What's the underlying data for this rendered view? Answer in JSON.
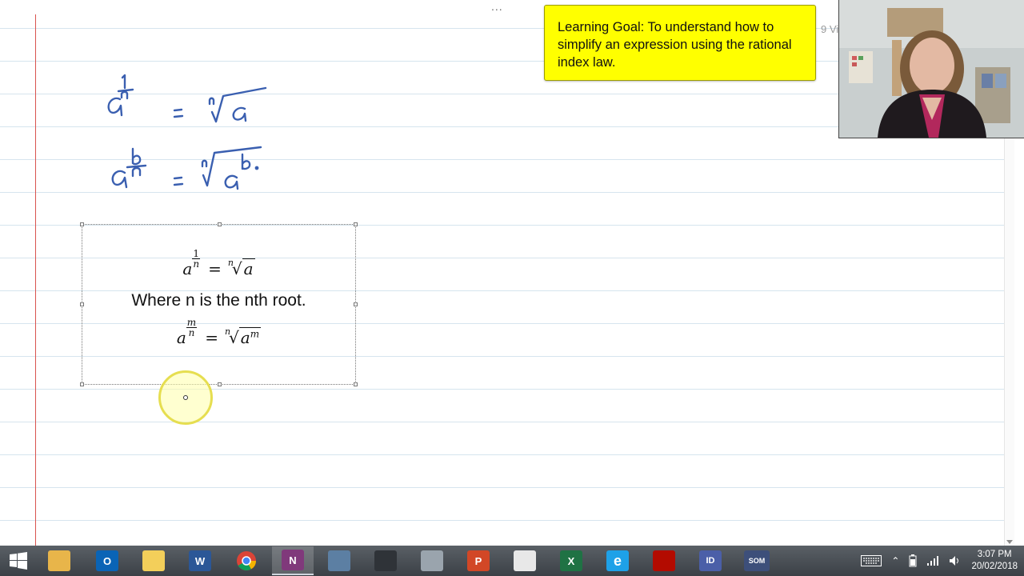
{
  "toolbar": {
    "more": "..."
  },
  "note": {
    "learning_goal": "Learning Goal: To understand how to simplify an expression using the rational index law.",
    "hidden_peek": "9 Vi"
  },
  "formula_box": {
    "f1": {
      "base": "a",
      "num": "1",
      "den": "n",
      "eq": "=",
      "root_index": "n",
      "radicand": "a"
    },
    "description": "Where n is the nth root.",
    "f2": {
      "base": "a",
      "num": "m",
      "den": "n",
      "eq": "=",
      "root_index": "n",
      "radicand": "a",
      "power": "m"
    }
  },
  "taskbar": {
    "apps": [
      {
        "name": "start-button",
        "glyph": ""
      },
      {
        "name": "file-explorer",
        "glyph": ""
      },
      {
        "name": "outlook",
        "glyph": "O"
      },
      {
        "name": "explorer-folder",
        "glyph": ""
      },
      {
        "name": "word",
        "glyph": "W"
      },
      {
        "name": "chrome",
        "glyph": ""
      },
      {
        "name": "onenote",
        "glyph": "N"
      },
      {
        "name": "calculator",
        "glyph": ""
      },
      {
        "name": "graphing-calculator",
        "glyph": ""
      },
      {
        "name": "snipping-tool",
        "glyph": ""
      },
      {
        "name": "powerpoint",
        "glyph": "P"
      },
      {
        "name": "acrobat",
        "glyph": ""
      },
      {
        "name": "excel",
        "glyph": "X"
      },
      {
        "name": "internet-explorer",
        "glyph": "e"
      },
      {
        "name": "acrobat-reader",
        "glyph": ""
      },
      {
        "name": "indesign",
        "glyph": "ID"
      },
      {
        "name": "som-app",
        "glyph": "SOM"
      }
    ],
    "time": "3:07 PM",
    "date": "20/02/2018"
  },
  "colors": {
    "note_bg": "#ffff00",
    "margin_line": "#d9534f",
    "rule_line": "#d6e4ee",
    "ink": "#3a5fb0",
    "cursor_highlight": "#e6de50"
  }
}
